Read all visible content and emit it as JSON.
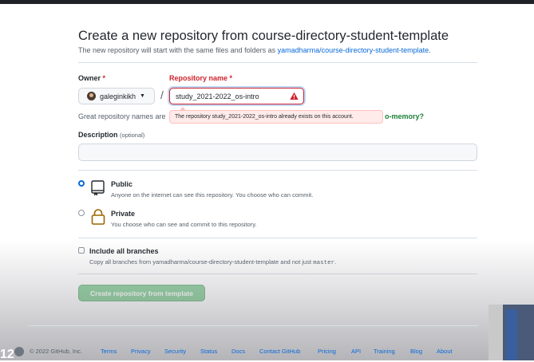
{
  "page": {
    "title": "Create a new repository from course-directory-student-template",
    "subtitle_prefix": "The new repository will start with the same files and folders as ",
    "subtitle_link": "yamadharma/course-directory-student-template",
    "subtitle_suffix": "."
  },
  "form": {
    "owner_label": "Owner",
    "owner_required": "*",
    "owner_value": "galeginkikh",
    "separator": "/",
    "repo_label": "Repository name",
    "repo_required": "*",
    "repo_value": "study_2021-2022_os-intro",
    "error_tooltip": "The repository study_2021-2022_os-intro already exists on this account.",
    "hint_prefix": "Great repository names are",
    "hint_suggestion": "o-memory?",
    "description_label": "Description",
    "description_optional": "(optional)",
    "description_value": ""
  },
  "visibility": {
    "public": {
      "title": "Public",
      "description": "Anyone on the internet can see this repository. You choose who can commit.",
      "checked": true
    },
    "private": {
      "title": "Private",
      "description": "You choose who can see and commit to this repository.",
      "checked": false
    }
  },
  "branches": {
    "label": "Include all branches",
    "description_prefix": "Copy all branches from yamadharma/course-directory-student-template and not just ",
    "description_code": "master",
    "description_suffix": ".",
    "checked": false
  },
  "create_button": "Create repository from template",
  "footer": {
    "copyright": "© 2022 GitHub, Inc.",
    "links": [
      "Terms",
      "Privacy",
      "Security",
      "Status",
      "Docs",
      "Contact GitHub",
      "Pricing",
      "API",
      "Training",
      "Blog",
      "About"
    ]
  },
  "overlay": {
    "corner_text": "12"
  },
  "colors": {
    "accent": "#0969da",
    "danger": "#cf222e",
    "success_disabled": "#94d3a2",
    "text": "#24292f"
  }
}
